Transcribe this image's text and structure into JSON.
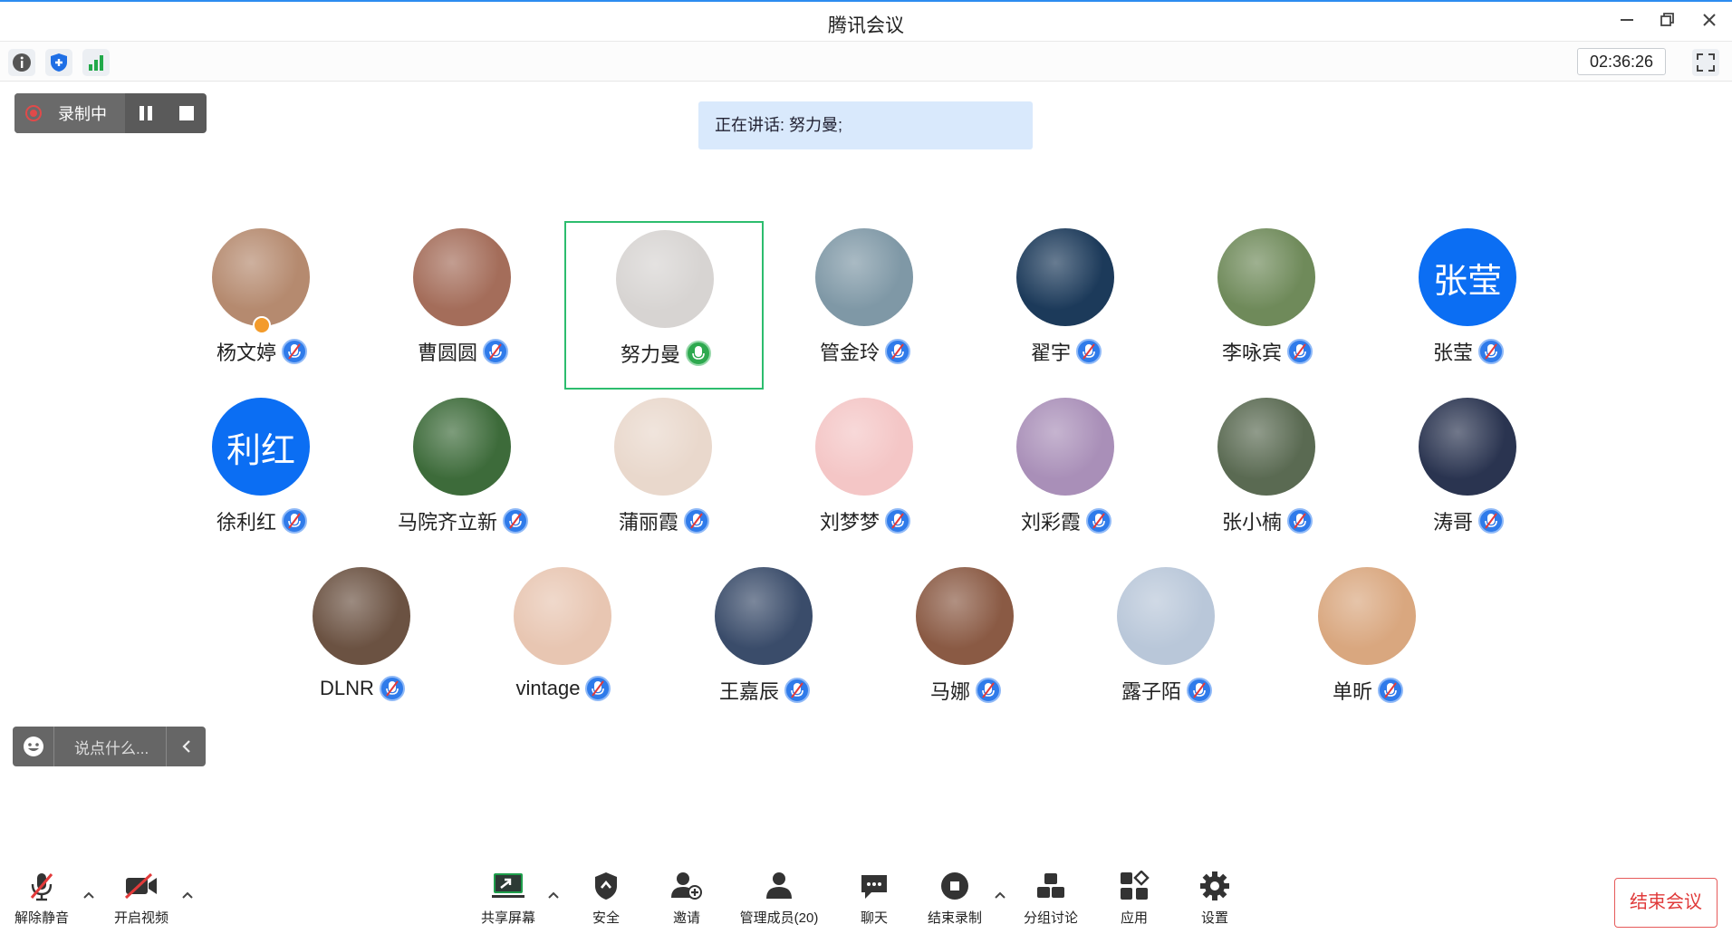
{
  "window": {
    "title": "腾讯会议"
  },
  "toolbar": {
    "timer": "02:36:26"
  },
  "recording": {
    "label": "录制中"
  },
  "speaker_banner": "正在讲话: 努力曼;",
  "participants": [
    {
      "name": "杨文婷",
      "mic": "muted",
      "host": true,
      "avatar_color": "#b58a6f"
    },
    {
      "name": "曹圆圆",
      "mic": "muted",
      "avatar_color": "#a46d5a"
    },
    {
      "name": "努力曼",
      "mic": "speaking",
      "active": true,
      "avatar_color": "#d7d4d2"
    },
    {
      "name": "管金玲",
      "mic": "muted",
      "avatar_color": "#7f98a6"
    },
    {
      "name": "翟宇",
      "mic": "muted",
      "avatar_color": "#1c3a5a"
    },
    {
      "name": "李咏宾",
      "mic": "muted",
      "avatar_color": "#6f8a5a"
    },
    {
      "name": "张莹",
      "mic": "muted",
      "avatar_text": "张莹"
    },
    {
      "name": "徐利红",
      "mic": "muted",
      "avatar_text": "利红"
    },
    {
      "name": "马院齐立新",
      "mic": "muted",
      "avatar_color": "#3d6b3a"
    },
    {
      "name": "蒲丽霞",
      "mic": "muted",
      "avatar_color": "#e9d8cc"
    },
    {
      "name": "刘梦梦",
      "mic": "muted",
      "avatar_color": "#f4c6c6"
    },
    {
      "name": "刘彩霞",
      "mic": "muted",
      "avatar_color": "#a98fb8"
    },
    {
      "name": "张小楠",
      "mic": "muted",
      "avatar_color": "#5a6a52"
    },
    {
      "name": "涛哥",
      "mic": "muted",
      "avatar_color": "#2a3450"
    },
    {
      "name": "DLNR",
      "mic": "muted",
      "avatar_color": "#6b5242"
    },
    {
      "name": "vintage",
      "mic": "muted",
      "avatar_color": "#e8c6b2"
    },
    {
      "name": "王嘉辰",
      "mic": "muted",
      "avatar_color": "#3a4c6a"
    },
    {
      "name": "马娜",
      "mic": "muted",
      "avatar_color": "#8a5a44"
    },
    {
      "name": "露子陌",
      "mic": "muted",
      "avatar_color": "#b9c7d9"
    },
    {
      "name": "单昕",
      "mic": "muted",
      "avatar_color": "#d9a77f"
    }
  ],
  "chat": {
    "placeholder": "说点什么..."
  },
  "controls": {
    "unmute": "解除静音",
    "video": "开启视频",
    "share": "共享屏幕",
    "security": "安全",
    "invite": "邀请",
    "members": "管理成员(20)",
    "chat": "聊天",
    "end_recording": "结束录制",
    "breakout": "分组讨论",
    "apps": "应用",
    "settings": "设置",
    "end_meeting": "结束会议"
  },
  "colors": {
    "accent": "#0b6ef3",
    "speaking_green": "#2ea94f",
    "end_red": "#e03a3a"
  }
}
